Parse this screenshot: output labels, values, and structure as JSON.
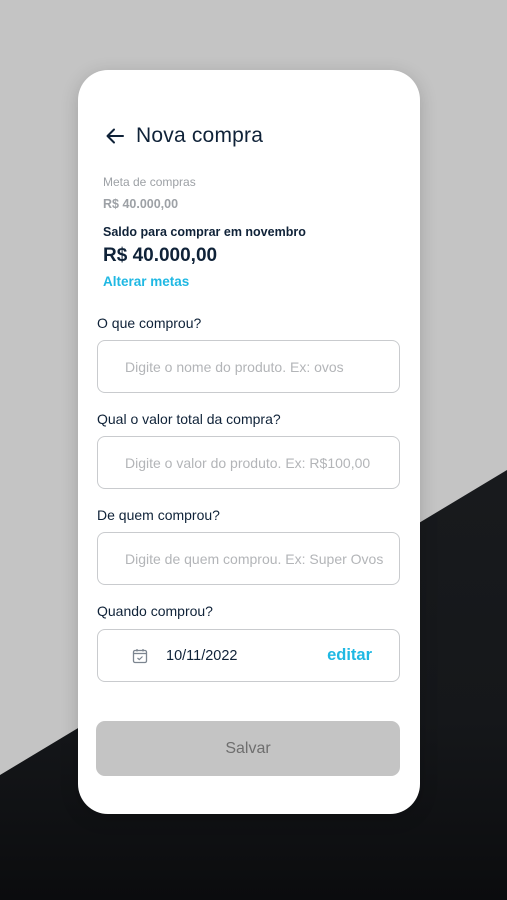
{
  "header": {
    "title": "Nova compra",
    "back_icon": "arrow-left-icon"
  },
  "goal": {
    "label": "Meta de compras",
    "value": "R$ 40.000,00"
  },
  "balance": {
    "label": "Saldo para comprar em novembro",
    "value": "R$ 40.000,00"
  },
  "edit_goals_label": "Alterar metas",
  "fields": {
    "product": {
      "label": "O que comprou?",
      "placeholder": "Digite o nome do produto. Ex: ovos",
      "value": ""
    },
    "total": {
      "label": "Qual o valor total da compra?",
      "placeholder": "Digite o valor do produto. Ex: R$100,00",
      "value": ""
    },
    "seller": {
      "label": "De quem comprou?",
      "placeholder": "Digite de quem comprou. Ex: Super Ovos",
      "value": ""
    },
    "date": {
      "label": "Quando comprou?",
      "value": "10/11/2022",
      "edit_label": "editar",
      "icon": "calendar-icon"
    }
  },
  "save_label": "Salvar",
  "colors": {
    "accent": "#1fb8e3",
    "text_dark": "#0f2238",
    "disabled_button": "#c4c4c4"
  }
}
